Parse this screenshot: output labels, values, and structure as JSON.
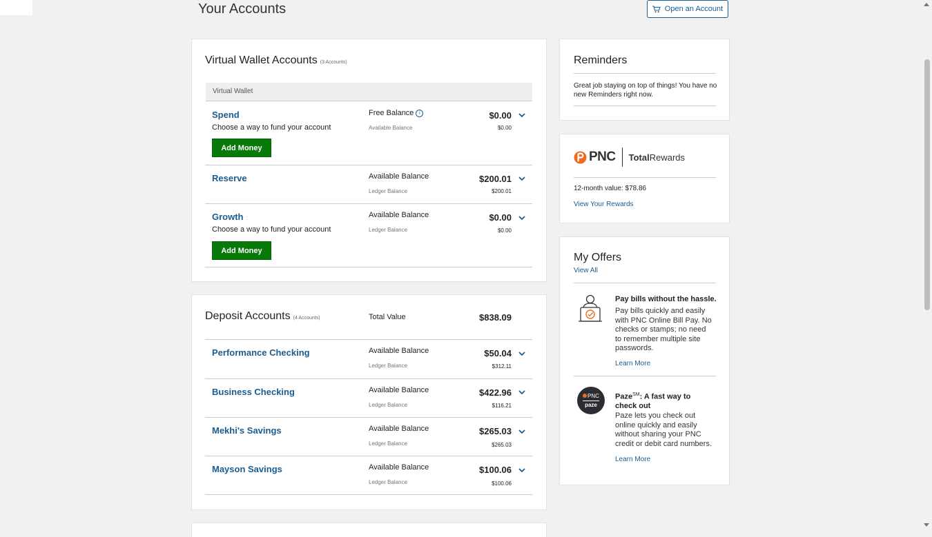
{
  "header": {
    "title": "Your Accounts",
    "open_account_label": "Open an Account"
  },
  "virtual_wallet": {
    "title": "Virtual Wallet Accounts",
    "count": "(3 Accounts)",
    "subheader": "Virtual Wallet",
    "accounts": [
      {
        "name": "Spend",
        "desc": "Choose a way to fund your account",
        "balance_label": "Free Balance",
        "balance_sub": "Available Balance",
        "amount": "$0.00",
        "amount_sub": "$0.00",
        "button": "Add Money"
      },
      {
        "name": "Reserve",
        "desc": "",
        "balance_label": "Available Balance",
        "balance_sub": "Ledger Balance",
        "amount": "$200.01",
        "amount_sub": "$200.01"
      },
      {
        "name": "Growth",
        "marker": ":",
        "desc": "Choose a way to fund your account",
        "balance_label": "Available Balance",
        "balance_sub": "Ledger Balance",
        "amount": "$0.00",
        "amount_sub": "$0.00",
        "button": "Add Money"
      }
    ]
  },
  "deposit": {
    "title": "Deposit Accounts",
    "count": "(4 Accounts)",
    "total_label": "Total Value",
    "total_value": "$838.09",
    "accounts": [
      {
        "name": "Performance Checking",
        "balance_label": "Available Balance",
        "balance_sub": "Ledger Balance",
        "amount": "$50.04",
        "amount_sub": "$312.11"
      },
      {
        "name": "Business Checking",
        "balance_label": "Available Balance",
        "balance_sub": "Ledger Balance",
        "amount": "$422.96",
        "amount_sub": "$116.21"
      },
      {
        "name": "Mekhi's Savings",
        "balance_label": "Available Balance",
        "balance_sub": "Ledger Balance",
        "amount": "$265.03",
        "amount_sub": "$265.03"
      },
      {
        "name": "Mayson Savings",
        "balance_label": "Available Balance",
        "balance_sub": "Ledger Balance",
        "amount": "$100.06",
        "amount_sub": "$100.06"
      }
    ]
  },
  "reminders": {
    "title": "Reminders",
    "text": "Great job staying on top of things! You have no new Reminders right now."
  },
  "rewards": {
    "brand": "PNC",
    "program_bold": "Total",
    "program_rest": "Rewards",
    "value_label": "12-month value:",
    "value": "$78.86",
    "link": "View Your Rewards"
  },
  "offers": {
    "title": "My Offers",
    "view_all": "View All",
    "items": [
      {
        "title": "Pay bills without the hassle.",
        "text": "Pay bills quickly and easily with PNC Online Bill Pay. No checks or stamps; no need to remember multiple site passwords.",
        "link": "Learn More",
        "icon": "bill-pay-icon"
      },
      {
        "title_main": "Paze",
        "title_sup": "SM",
        "title_rest": ": A fast way to check out",
        "text": "Paze lets you check out online quickly and easily without sharing your PNC credit or debit card numbers.",
        "link": "Learn More",
        "icon": "paze-logo-icon",
        "logo_top": "PNC",
        "logo_bottom": "paze"
      }
    ]
  },
  "colors": {
    "brand_blue": "#1b5c8e",
    "add_money_green": "#087a09",
    "pnc_orange": "#ef6a1f"
  }
}
